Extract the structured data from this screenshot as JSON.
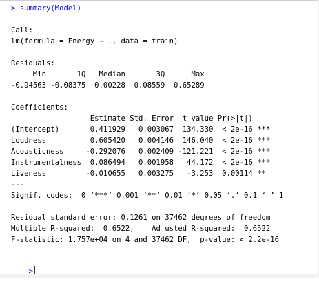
{
  "console": {
    "command": "> summary(Model)",
    "call_header": "Call:",
    "call": "lm(formula = Energy ~ ., data = train)",
    "residuals_header": "Residuals:",
    "residuals_labels": "     Min       1Q   Median       3Q      Max ",
    "residuals_values": "-0.94563 -0.08375  0.00228  0.08559  0.65289 ",
    "coefficients_header": "Coefficients:",
    "coef_table_header": "                  Estimate Std. Error  t value Pr(>|t|)    ",
    "coef_rows": [
      "(Intercept)       0.411929   0.003067  134.330  < 2e-16 ***",
      "Loudness          0.605420   0.004146  146.040  < 2e-16 ***",
      "Acousticness     -0.292076   0.002409 -121.221  < 2e-16 ***",
      "Instrumentalness  0.086494   0.001958   44.172  < 2e-16 ***",
      "Liveness         -0.010655   0.003275   -3.253  0.00114 ** "
    ],
    "separator": "---",
    "signif_codes": "Signif. codes:  0 ‘***’ 0.001 ‘**’ 0.01 ‘*’ 0.05 ‘.’ 0.1 ‘ ’ 1",
    "residual_se": "Residual standard error: 0.1261 on 37462 degrees of freedom",
    "r_squared": "Multiple R-squared:  0.6522,\tAdjusted R-squared:  0.6522 ",
    "f_statistic": "F-statistic: 1.757e+04 on 4 and 37462 DF,  p-value: < 2.2e-16",
    "prompt": ">"
  },
  "colors": {
    "prompt": "#0000ff",
    "text": "#000000",
    "background": "#ffffff"
  }
}
